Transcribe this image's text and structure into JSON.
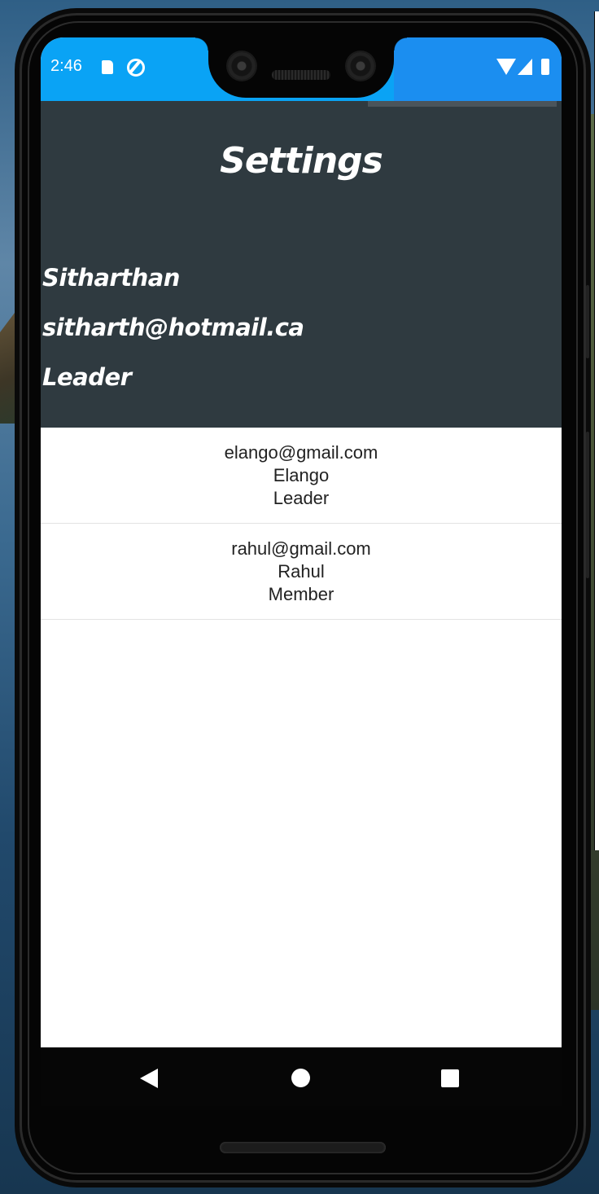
{
  "status_bar": {
    "time": "2:46",
    "icons": [
      "sd-card-icon",
      "sync-icon",
      "wifi-icon",
      "cell-signal-icon",
      "battery-icon"
    ],
    "color": "#0aa3f5"
  },
  "header": {
    "title": "Settings",
    "background": "#2f3a40"
  },
  "profile": {
    "name": "Sitharthan",
    "email": "sitharth@hotmail.ca",
    "role": "Leader"
  },
  "members": [
    {
      "email": "elango@gmail.com",
      "name": "Elango",
      "role": "Leader"
    },
    {
      "email": "rahul@gmail.com",
      "name": "Rahul",
      "role": "Member"
    }
  ],
  "nav_bar": {
    "icons": [
      "back-icon",
      "home-icon",
      "recents-icon"
    ]
  }
}
